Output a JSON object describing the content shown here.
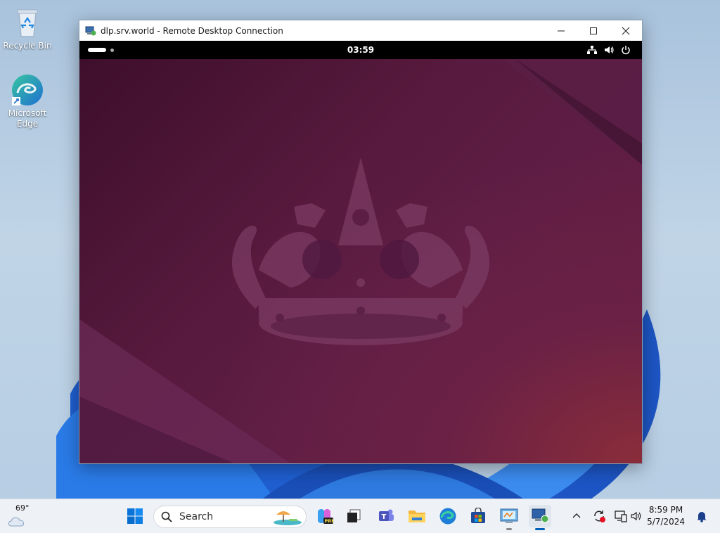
{
  "desktop": {
    "icons": [
      {
        "label": "Recycle Bin"
      },
      {
        "label": "Microsoft Edge"
      }
    ]
  },
  "rdp_window": {
    "title": "dlp.srv.world - Remote Desktop Connection",
    "controls": {
      "minimize": "minimize-icon",
      "maximize": "maximize-icon",
      "close": "close-icon"
    }
  },
  "gnome": {
    "clock": "03:59",
    "tray_icons": [
      "network-icon",
      "volume-icon",
      "power-icon"
    ]
  },
  "taskbar": {
    "weather_temp": "69°",
    "search_placeholder": "Search",
    "apps": [
      "start",
      "copilot",
      "task-view",
      "teams",
      "file-explorer",
      "edge",
      "store",
      "control-panel",
      "remote-desktop"
    ],
    "time": "8:59 PM",
    "date": "5/7/2024"
  },
  "colors": {
    "accent": "#005fb8",
    "ubuntu_dark": "#3e0f2c",
    "ubuntu_mid": "#5e1d45",
    "ubuntu_warm": "#8a2d3a"
  }
}
